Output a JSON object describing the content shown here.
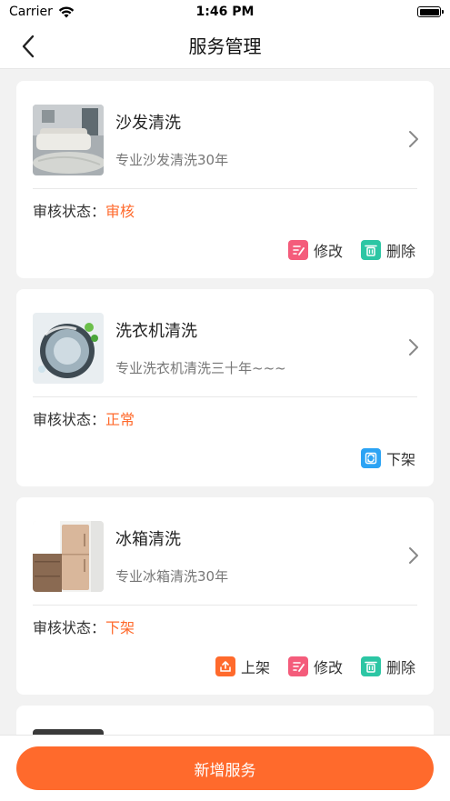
{
  "status_bar": {
    "carrier": "Carrier",
    "time": "1:46 PM"
  },
  "nav": {
    "title": "服务管理",
    "back_icon": "chevron-left-icon"
  },
  "labels": {
    "audit_status": "审核状态：",
    "edit": "修改",
    "delete": "删除",
    "take_down": "下架",
    "put_up": "上架"
  },
  "services": [
    {
      "title": "沙发清洗",
      "desc": "专业沙发清洗30年",
      "status": "审核",
      "thumb": "sofa-photo",
      "actions": [
        "edit",
        "delete"
      ]
    },
    {
      "title": "洗衣机清洗",
      "desc": "专业洗衣机清洗三十年~~~",
      "status": "正常",
      "thumb": "washing-machine-photo",
      "actions": [
        "take_down"
      ]
    },
    {
      "title": "冰箱清洗",
      "desc": "专业冰箱清洗30年",
      "status": "下架",
      "thumb": "fridge-photo",
      "actions": [
        "put_up",
        "edit",
        "delete"
      ]
    }
  ],
  "bottom": {
    "add_label": "新增服务"
  },
  "colors": {
    "accent": "#ff6a2c",
    "edit": "#f45c7b",
    "delete": "#2cc6a4",
    "offshelf": "#2ca3f4"
  }
}
